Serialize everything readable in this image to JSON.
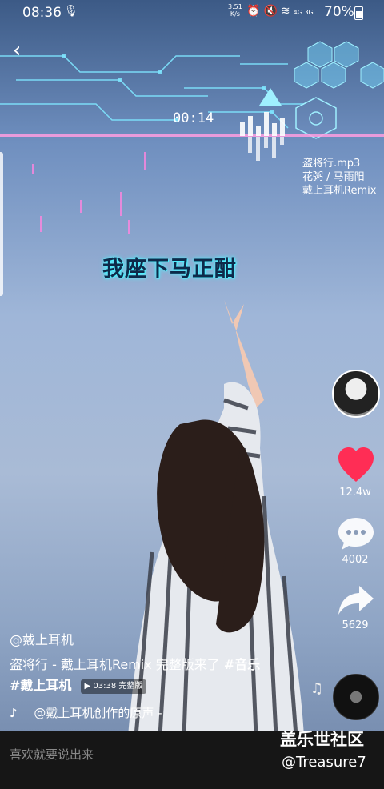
{
  "status_bar": {
    "time": "08:36",
    "speed_value": "3.51",
    "speed_unit": "K/s",
    "network": "4G 3G",
    "battery": "70%"
  },
  "video": {
    "hud_timer": "00:14",
    "song_file": "盗将行.mp3",
    "song_artists": "花粥 / 马雨阳",
    "song_remix": "戴上耳机Remix",
    "lyric": "我座下马正酣"
  },
  "actions": {
    "likes": "12.4w",
    "comments": "4002",
    "shares": "5629"
  },
  "post": {
    "author": "@戴上耳机",
    "desc_text": "盗将行 - 戴上耳机Remix 完整版来了 ",
    "tag1": "#音乐",
    "tag2": "#戴上耳机",
    "badge": "▶ 03:38 完整版",
    "music": "@戴上耳机创作的原声 -"
  },
  "comment_placeholder": "喜欢就要说出来",
  "watermark": {
    "title": "盖乐世社区",
    "user": "@Treasure7"
  },
  "colors": {
    "like": "#ff2d55",
    "bottom_bar": "#161616",
    "lyric_glow": "#4ff0ff"
  }
}
